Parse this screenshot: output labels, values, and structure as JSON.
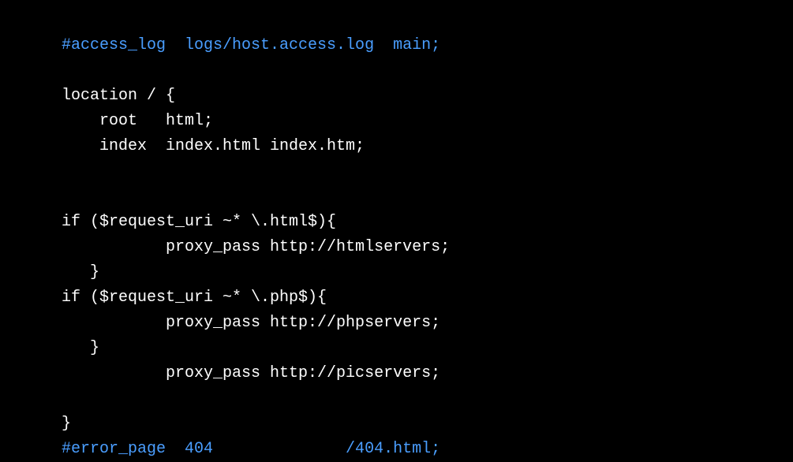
{
  "code": {
    "line1_comment": "#access_log  logs/host.access.log  main;",
    "line2_blank": "",
    "line3": "location / {",
    "line4": "    root   html;",
    "line5": "    index  index.html index.htm;",
    "line6_blank": "",
    "line7_blank": "",
    "line8": "if ($request_uri ~* \\.html$){",
    "line9": "           proxy_pass http://htmlservers;",
    "line10": "   }",
    "line11": "if ($request_uri ~* \\.php$){",
    "line12": "           proxy_pass http://phpservers;",
    "line13": "   }",
    "line14": "           proxy_pass http://picservers;",
    "line15_blank": "",
    "line16": "}",
    "line17_comment": "#error_page  404              /404.html;"
  }
}
